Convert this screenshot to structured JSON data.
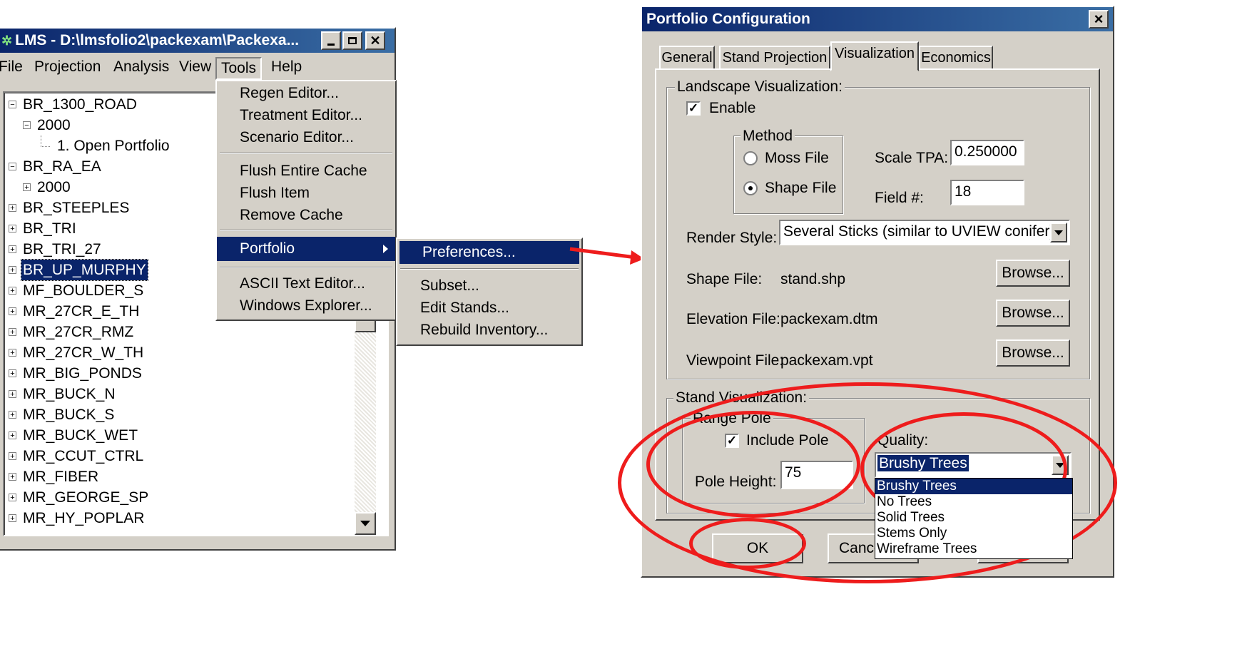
{
  "lms": {
    "title": "LMS - D:\\lmsfolio2\\packexam\\Packexa...",
    "menu": [
      "File",
      "Projection",
      "Analysis",
      "View",
      "Tools",
      "Help"
    ],
    "tree": [
      {
        "label": "BR_1300_ROAD",
        "level": 0,
        "expander": "minus"
      },
      {
        "label": "2000",
        "level": 1,
        "expander": "minus"
      },
      {
        "label": "1.  Open Portfolio",
        "level": 2,
        "expander": "none"
      },
      {
        "label": "BR_RA_EA",
        "level": 0,
        "expander": "minus"
      },
      {
        "label": "2000",
        "level": 1,
        "expander": "plus"
      },
      {
        "label": "BR_STEEPLES",
        "level": 0,
        "expander": "plus"
      },
      {
        "label": "BR_TRI",
        "level": 0,
        "expander": "plus"
      },
      {
        "label": "BR_TRI_27",
        "level": 0,
        "expander": "plus"
      },
      {
        "label": "BR_UP_MURPHY",
        "level": 0,
        "expander": "plus",
        "selected": true
      },
      {
        "label": "MF_BOULDER_S",
        "level": 0,
        "expander": "plus"
      },
      {
        "label": "MR_27CR_E_TH",
        "level": 0,
        "expander": "plus"
      },
      {
        "label": "MR_27CR_RMZ",
        "level": 0,
        "expander": "plus"
      },
      {
        "label": "MR_27CR_W_TH",
        "level": 0,
        "expander": "plus"
      },
      {
        "label": "MR_BIG_PONDS",
        "level": 0,
        "expander": "plus"
      },
      {
        "label": "MR_BUCK_N",
        "level": 0,
        "expander": "plus"
      },
      {
        "label": "MR_BUCK_S",
        "level": 0,
        "expander": "plus"
      },
      {
        "label": "MR_BUCK_WET",
        "level": 0,
        "expander": "plus"
      },
      {
        "label": "MR_CCUT_CTRL",
        "level": 0,
        "expander": "plus"
      },
      {
        "label": "MR_FIBER",
        "level": 0,
        "expander": "plus"
      },
      {
        "label": "MR_GEORGE_SP",
        "level": 0,
        "expander": "plus"
      },
      {
        "label": "MR_HY_POPLAR",
        "level": 0,
        "expander": "plus"
      }
    ],
    "tools_menu": {
      "group1": [
        "Regen Editor...",
        "Treatment Editor...",
        "Scenario Editor..."
      ],
      "group2": [
        "Flush Entire Cache",
        "Flush Item",
        "Remove Cache"
      ],
      "portfolio": "Portfolio",
      "group3": [
        "ASCII Text Editor...",
        "Windows Explorer..."
      ]
    },
    "portfolio_menu": {
      "preferences": "Preferences...",
      "items": [
        "Subset...",
        "Edit Stands...",
        "Rebuild Inventory..."
      ]
    }
  },
  "dialog": {
    "title": "Portfolio Configuration",
    "close_label": "×",
    "tabs": [
      "General",
      "Stand Projection",
      "Visualization",
      "Economics"
    ],
    "active_tab": "Visualization",
    "landscape": {
      "legend": "Landscape Visualization:",
      "enable_label": "Enable",
      "enable_checked": true,
      "method_legend": "Method",
      "moss_label": "Moss File",
      "shape_label": "Shape File",
      "selected_method": "Shape File",
      "scale_tpa_label": "Scale TPA:",
      "scale_tpa_value": "0.250000",
      "field_label": "Field #:",
      "field_value": "18",
      "render_style_label": "Render Style:",
      "render_style_value": "Several Sticks (similar to UVIEW conifer)",
      "shape_file_label": "Shape File:",
      "shape_file_value": "stand.shp",
      "elevation_label": "Elevation File:",
      "elevation_value": "packexam.dtm",
      "viewpoint_label": "Viewpoint File:",
      "viewpoint_value": "packexam.vpt",
      "browse_label": "Browse..."
    },
    "stand": {
      "legend": "Stand Visualization:",
      "range_pole_legend": "Range Pole",
      "include_pole_label": "Include Pole",
      "include_pole_checked": true,
      "pole_height_label": "Pole Height:",
      "pole_height_value": "75",
      "quality_label": "Quality:",
      "quality_value": "Brushy Trees",
      "quality_options": [
        "Brushy Trees",
        "No Trees",
        "Solid Trees",
        "Stems Only",
        "Wireframe Trees"
      ]
    },
    "buttons": {
      "ok": "OK",
      "cancel": "Cance"
    }
  },
  "colors": {
    "highlight": "#0a246a",
    "annotation": "#ee1c1c",
    "face": "#d4d0c8"
  }
}
